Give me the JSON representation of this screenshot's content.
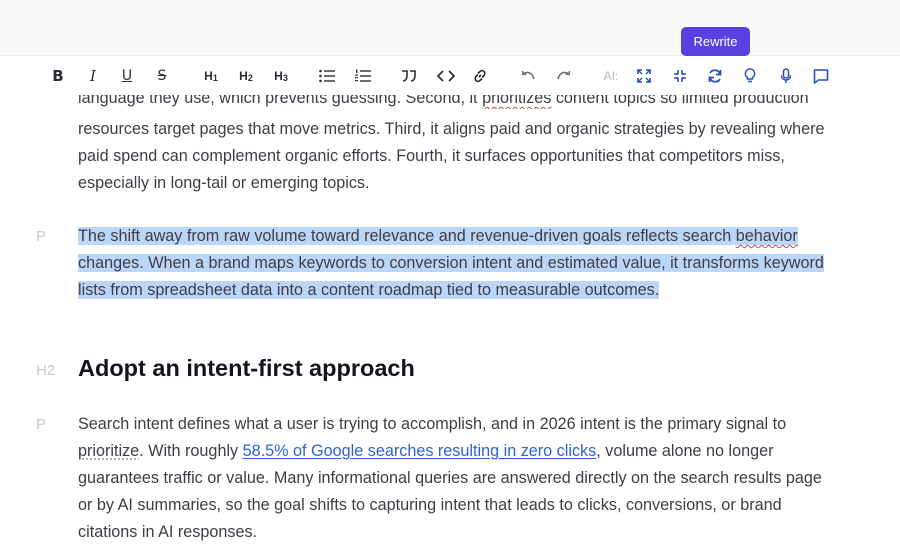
{
  "app": {
    "rewrite_label": "Rewrite",
    "accent_color": "#5b3fe0",
    "highlight_color": "#bcd6f7"
  },
  "toolbar": {
    "bold": "B",
    "italic": "I",
    "underline": "U",
    "strike": "S",
    "h1": "H",
    "h1_sub": "1",
    "h2": "H",
    "h2_sub": "2",
    "h3": "H",
    "h3_sub": "3",
    "ai_label": "AI:",
    "icons": [
      "bullet-list-icon",
      "numbered-list-icon",
      "quote-icon",
      "code-icon",
      "link-icon",
      "undo-icon",
      "redo-icon",
      "expand-icon",
      "collapse-icon",
      "refresh-icon",
      "lightbulb-icon",
      "microphone-icon",
      "comment-icon"
    ]
  },
  "doc": {
    "para1": {
      "line0_a": "language they use, which prevents guessing. Second, it ",
      "line0_sq": "prioritizes",
      "line0_b": " content topics so limited production",
      "line1": "resources target pages that move metrics. Third, it aligns paid and organic strategies by revealing where",
      "line2": "paid spend can complement organic efforts. Fourth, it surfaces opportunities that competitors miss,",
      "line3": "especially in long-tail or emerging topics."
    },
    "para2": {
      "label": "P",
      "line0_a": "The shift away from raw volume toward relevance and revenue-driven goals reflects search ",
      "line0_sq": "behavior",
      "line1": "changes. When a brand maps keywords to conversion intent and estimated value, it transforms keyword",
      "line2": "lists from spreadsheet data into a content roadmap tied to measurable outcomes."
    },
    "heading": {
      "label": "H2",
      "text": "Adopt an intent-first approach"
    },
    "para3": {
      "label": "P",
      "line0": "Search intent defines what a user is trying to accomplish, and in 2026 intent is the primary signal to",
      "line1_dot": "prioritize",
      "line1_a": ". With roughly ",
      "line1_link": "58.5% of Google searches resulting in zero clicks",
      "line1_b": ", volume alone no longer",
      "line2": "guarantees traffic or value. Many informational queries are answered directly on the search results page",
      "line3": "or by AI summaries, so the goal shifts to capturing intent that leads to clicks, conversions, or brand",
      "line4": "citations in AI responses."
    }
  }
}
